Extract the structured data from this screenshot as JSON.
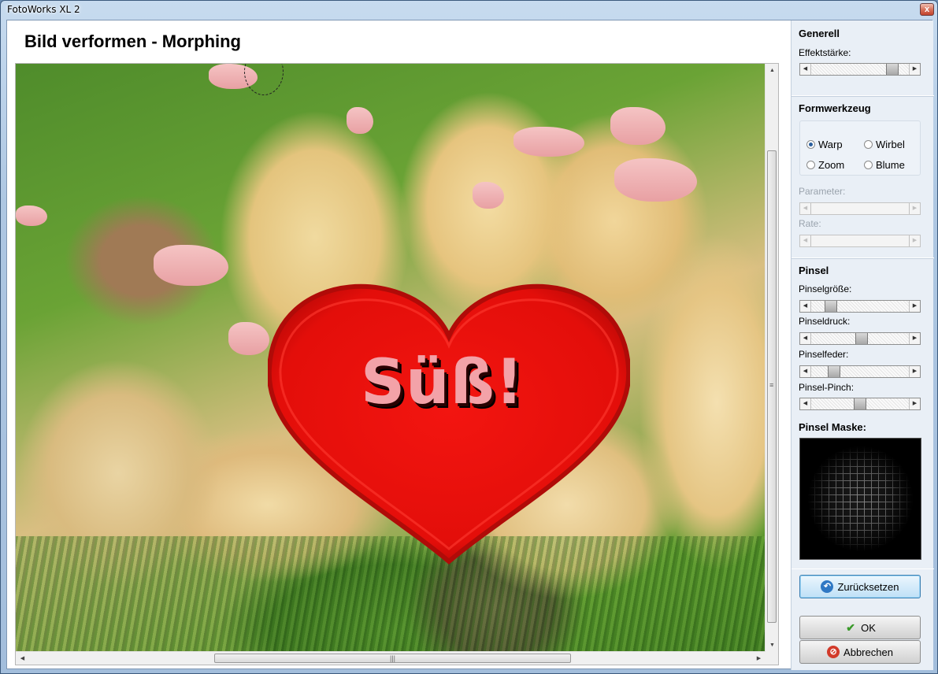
{
  "window": {
    "title": "FotoWorks XL 2",
    "close_glyph": "x"
  },
  "page": {
    "title": "Bild verformen - Morphing"
  },
  "image": {
    "overlay_text": "Süß!"
  },
  "panel": {
    "generell": {
      "title": "Generell",
      "effect_label": "Effektstärke:",
      "effect_level": 0.88
    },
    "formwerkzeug": {
      "title": "Formwerkzeug",
      "options": [
        {
          "label": "Warp",
          "selected": true
        },
        {
          "label": "Wirbel",
          "selected": false
        },
        {
          "label": "Zoom",
          "selected": false
        },
        {
          "label": "Blume",
          "selected": false
        }
      ],
      "parameter_label": "Parameter:",
      "rate_label": "Rate:"
    },
    "pinsel": {
      "title": "Pinsel",
      "size_label": "Pinselgröße:",
      "size_level": 0.16,
      "pressure_label": "Pinseldruck:",
      "pressure_level": 0.52,
      "feather_label": "Pinselfeder:",
      "feather_level": 0.19,
      "pinch_label": "Pinsel-Pinch:",
      "pinch_level": 0.5,
      "mask_label": "Pinsel Maske:"
    },
    "buttons": {
      "reset": "Zurücksetzen",
      "ok": "OK",
      "cancel": "Abbrechen"
    }
  },
  "icons": {
    "reset": "reset-arrow-icon",
    "ok": "checkmark-icon",
    "cancel": "cancel-icon"
  },
  "colors": {
    "heart": "#e8120d",
    "accent": "#3c7fb1"
  }
}
